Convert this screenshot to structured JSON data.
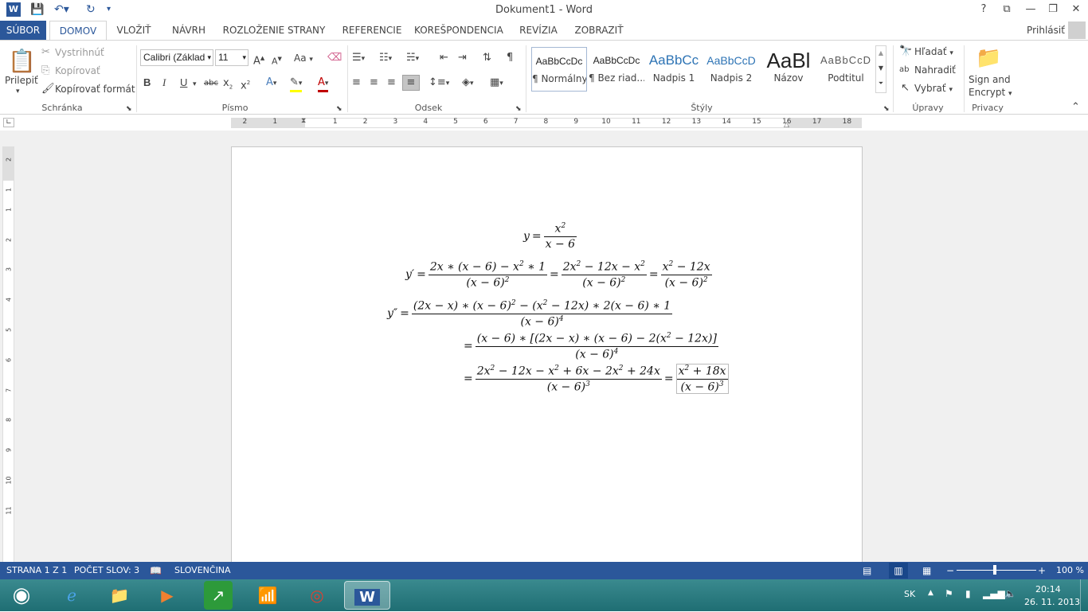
{
  "titlebar": {
    "title": "Dokument1 - Word",
    "help": "?",
    "undo_icon": "undo-icon",
    "redo_icon": "redo-icon",
    "save_icon": "save-icon"
  },
  "tabs": [
    "SÚBOR",
    "DOMOV",
    "VLOŽIŤ",
    "NÁVRH",
    "ROZLOŽENIE STRANY",
    "REFERENCIE",
    "KOREŠPONDENCIA",
    "REVÍZIA",
    "ZOBRAZIŤ"
  ],
  "signin": "Prihlásiť",
  "clipboard": {
    "paste": "Prilepiť",
    "cut": "Vystrihnúť",
    "copy": "Kopírovať",
    "format_painter": "Kopírovať formát",
    "label": "Schránka"
  },
  "font": {
    "name": "Calibri (Základ",
    "size": "11",
    "label": "Písmo",
    "case": "Aa"
  },
  "paragraph": {
    "label": "Odsek"
  },
  "styles": {
    "items": [
      {
        "preview": "AaBbCcDc",
        "name": "¶ Normálny"
      },
      {
        "preview": "AaBbCcDc",
        "name": "¶ Bez riad..."
      },
      {
        "preview": "AaBbCc",
        "name": "Nadpis 1"
      },
      {
        "preview": "AaBbCcD",
        "name": "Nadpis 2"
      },
      {
        "preview": "AaBl",
        "name": "Názov"
      },
      {
        "preview": "AaBbCcD",
        "name": "Podtitul"
      }
    ],
    "label": "Štýly"
  },
  "editing": {
    "find": "Hľadať",
    "replace": "Nahradiť",
    "select": "Vybrať",
    "label": "Úpravy"
  },
  "privacy": {
    "sign": "Sign and",
    "encrypt": "Encrypt",
    "label": "Privacy"
  },
  "ruler": {
    "ticks": [
      "2",
      "1",
      "1",
      "2",
      "3",
      "4",
      "5",
      "6",
      "7",
      "8",
      "9",
      "10",
      "11",
      "12",
      "13",
      "14",
      "15",
      "16",
      "17",
      "18"
    ],
    "vticks": [
      "2",
      "1",
      "1",
      "2",
      "3",
      "4",
      "5",
      "6",
      "7",
      "8",
      "9",
      "10",
      "11"
    ]
  },
  "status": {
    "page": "STRANA 1 Z 1",
    "words": "POČET SLOV: 3",
    "language": "SLOVENČINA",
    "zoom": "100 %"
  },
  "tray": {
    "lang": "SK",
    "time": "20:14",
    "date": "26. 11. 2013"
  },
  "colors": {
    "accent": "#2b579a",
    "font_color": "#c00000",
    "highlight": "#ffff00"
  }
}
